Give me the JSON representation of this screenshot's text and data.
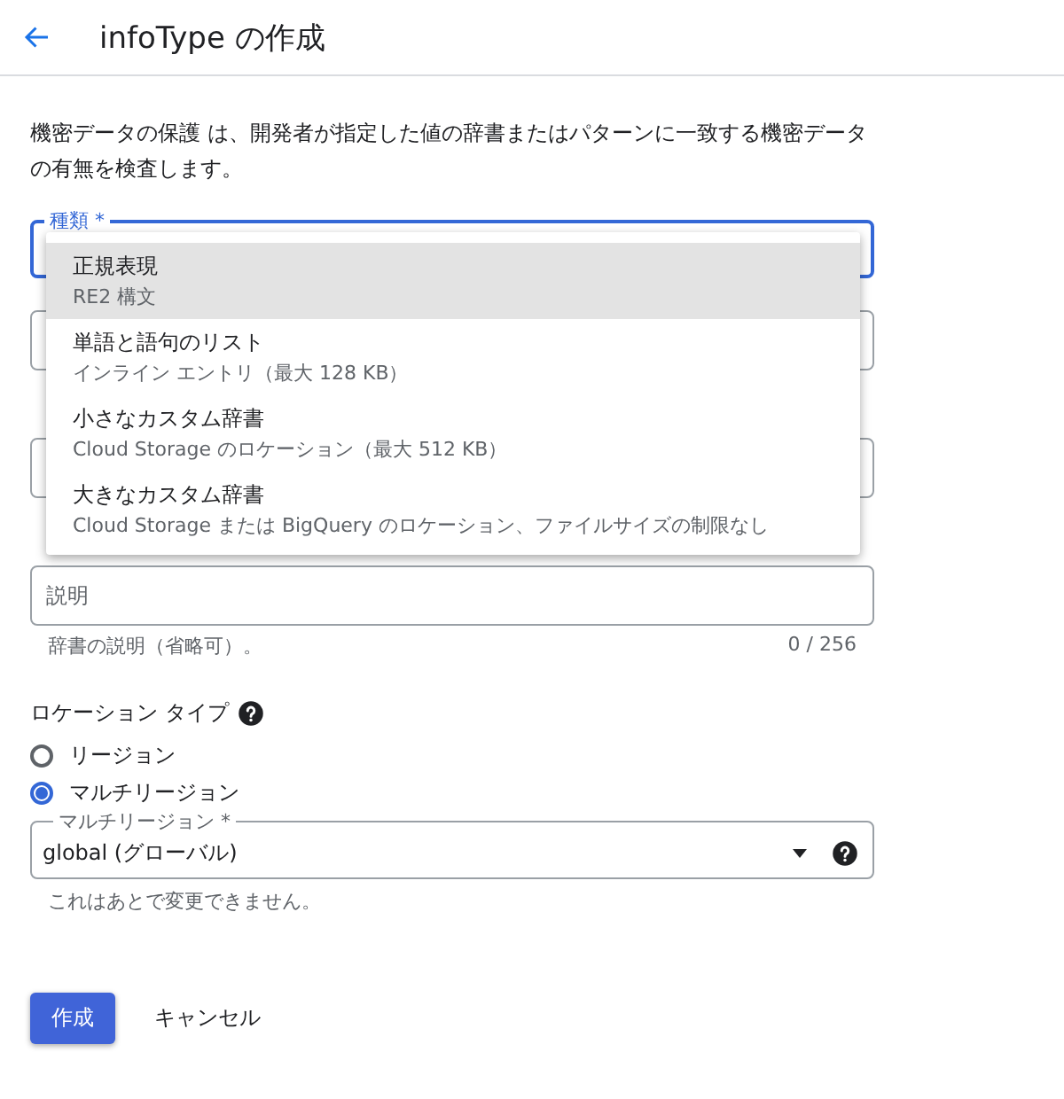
{
  "header": {
    "title": "infoType の作成"
  },
  "intro": "機密データの保護 は、開発者が指定した値の辞書またはパターンに一致する機密データの有無を検査します。",
  "type_field": {
    "label": "種類 *",
    "focused": true
  },
  "type_menu": [
    {
      "title": "正規表現",
      "subtitle": "RE2 構文",
      "selected": true
    },
    {
      "title": "単語と語句のリスト",
      "subtitle": "インライン エントリ（最大 128 KB）",
      "selected": false
    },
    {
      "title": "小さなカスタム辞書",
      "subtitle": "Cloud Storage のロケーション（最大 512 KB）",
      "selected": false
    },
    {
      "title": "大きなカスタム辞書",
      "subtitle": "Cloud Storage または BigQuery のロケーション、ファイルサイズの制限なし",
      "selected": false
    }
  ],
  "description_field": {
    "placeholder": "説明",
    "hint": "辞書の説明（省略可）。",
    "counter": "0 / 256"
  },
  "location_type": {
    "label": "ロケーション タイプ",
    "options": [
      {
        "label": "リージョン",
        "selected": false
      },
      {
        "label": "マルチリージョン",
        "selected": true
      }
    ]
  },
  "multi_region_select": {
    "label": "マルチリージョン *",
    "value": "global (グローバル)",
    "hint": "これはあとで変更できません。"
  },
  "buttons": {
    "create": "作成",
    "cancel": "キャンセル"
  }
}
